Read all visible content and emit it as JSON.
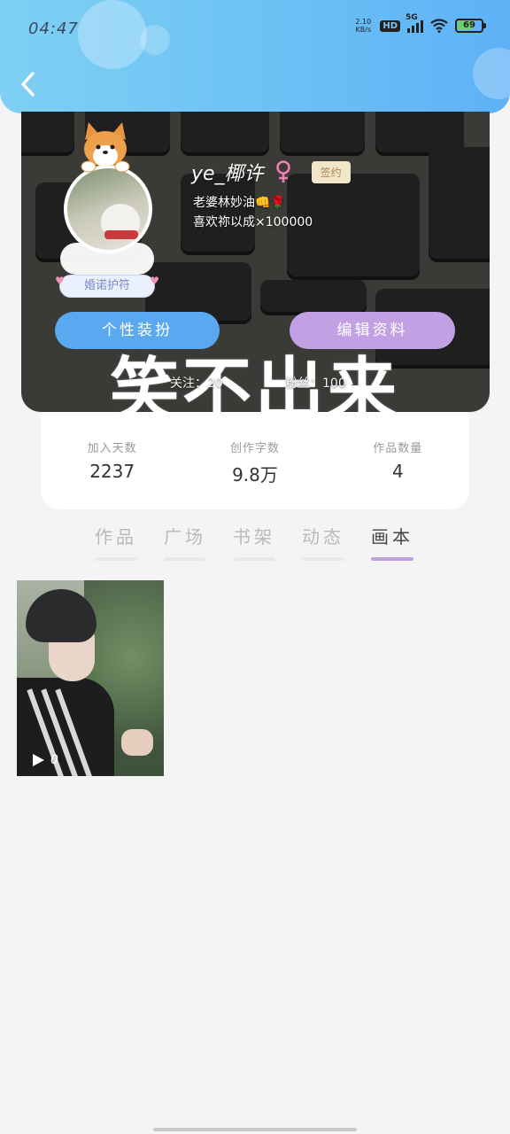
{
  "status_bar": {
    "time": "04:47",
    "net_speed_value": "2.10",
    "net_speed_unit": "KB/s",
    "hd_label": "HD",
    "network_label": "5G",
    "battery_level": "69"
  },
  "profile": {
    "username": "ye_椰许",
    "sign_badge": "签约",
    "bio_line1": "老婆林妙油👊🌹",
    "bio_line2": "喜欢祢以成×100000",
    "avatar_badge": "婚诺护符",
    "background_text": "笑不出来",
    "following_label": "关注：20",
    "followers_label": "粉丝：100",
    "outfit_button": "个性装扮",
    "edit_button": "编辑资料"
  },
  "stats": [
    {
      "label": "加入天数",
      "value": "2237"
    },
    {
      "label": "创作字数",
      "value": "9.8万"
    },
    {
      "label": "作品数量",
      "value": "4"
    }
  ],
  "tabs": [
    {
      "label": "作品"
    },
    {
      "label": "广场"
    },
    {
      "label": "书架"
    },
    {
      "label": "动态"
    },
    {
      "label": "画本"
    }
  ],
  "active_tab": "画本",
  "gallery": [
    {
      "play_count": "0"
    }
  ],
  "colors": {
    "header_gradient_start": "#7fd0f4",
    "header_gradient_end": "#5fb1f6",
    "outfit_button": "#5aa9f0",
    "edit_button": "#c1a1e4",
    "tab_indicator": "#c1a1e4",
    "sign_badge_bg": "#f2e6c9"
  }
}
